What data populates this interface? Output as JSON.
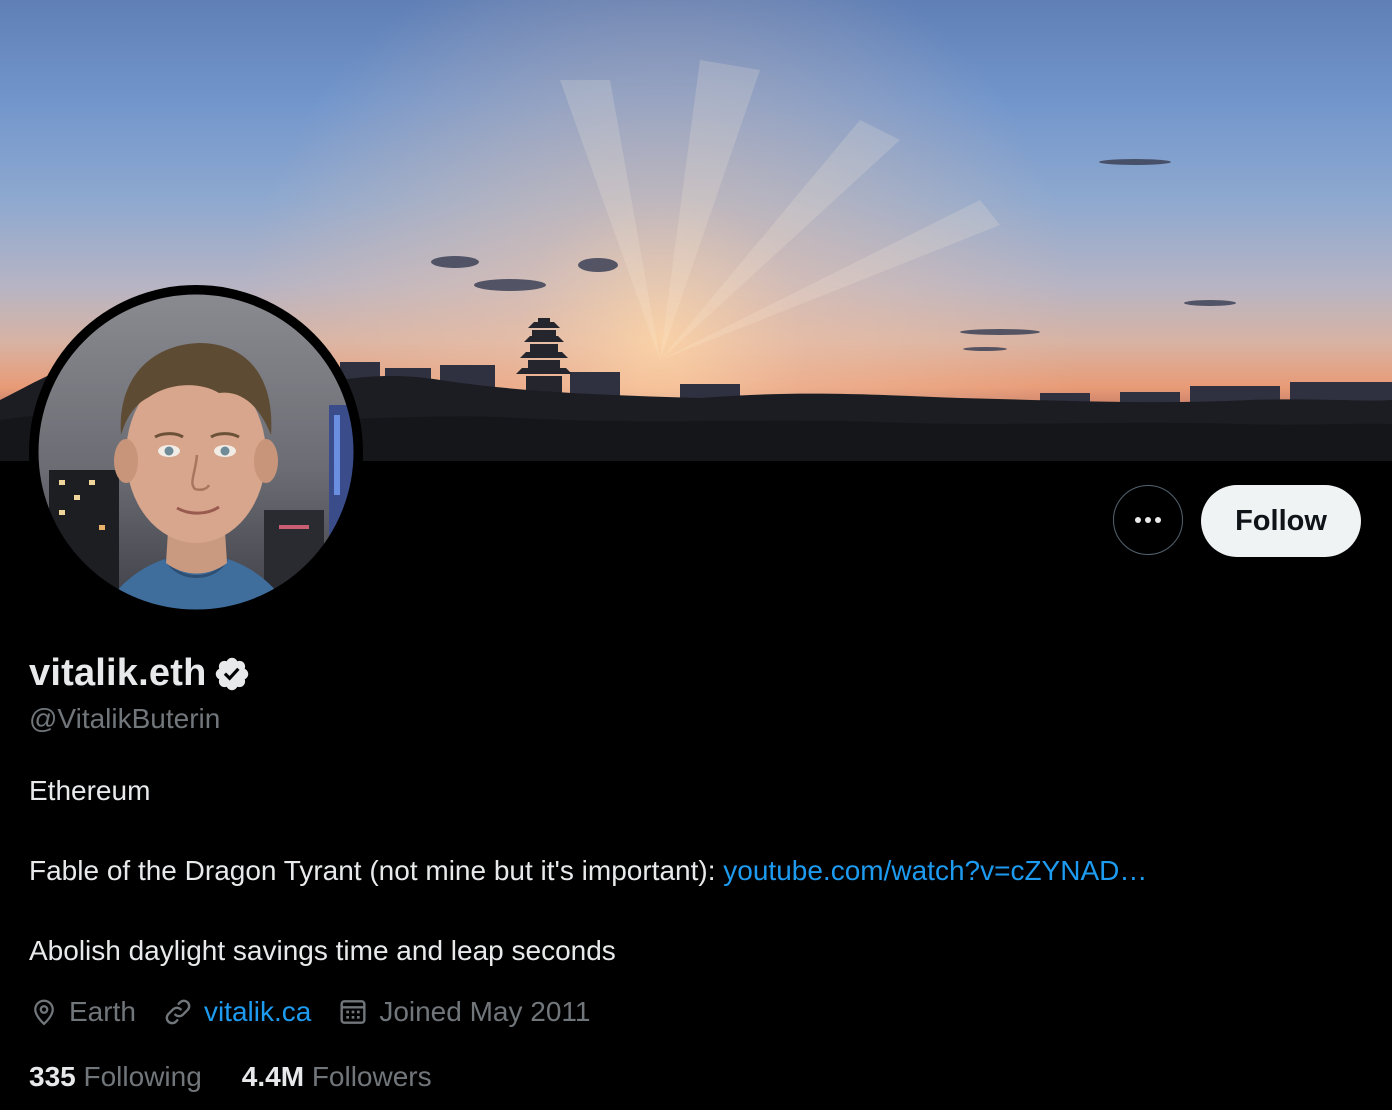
{
  "profile": {
    "display_name": "vitalik.eth",
    "handle": "@VitalikButerin",
    "verified": true,
    "bio_line1": "Ethereum",
    "bio_line2_text": "Fable of the Dragon Tyrant (not mine but it's important): ",
    "bio_line2_link": "youtube.com/watch?v=cZYNAD…",
    "bio_line3": "Abolish daylight savings time and leap seconds",
    "location": "Earth",
    "website": "vitalik.ca",
    "joined": "Joined May 2011",
    "following_count": "335",
    "following_label": "Following",
    "followers_count": "4.4M",
    "followers_label": "Followers"
  },
  "actions": {
    "follow_label": "Follow"
  },
  "colors": {
    "background": "#000000",
    "text_primary": "#e7e9ea",
    "text_secondary": "#71767b",
    "link": "#1d9bf0",
    "follow_bg": "#eff3f4"
  },
  "icons": {
    "more": "more-icon",
    "verified": "verified-badge-icon",
    "location": "location-pin-icon",
    "link": "link-icon",
    "calendar": "calendar-icon"
  }
}
